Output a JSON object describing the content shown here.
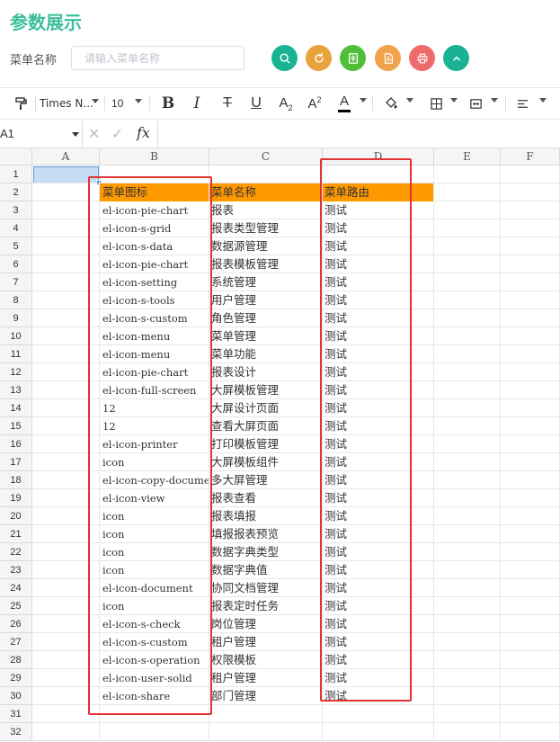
{
  "page": {
    "title": "参数展示"
  },
  "search": {
    "label": "菜单名称",
    "placeholder": "请输入菜单名称",
    "value": ""
  },
  "action_buttons": [
    {
      "name": "search-button",
      "icon": "search-icon",
      "color": "#19b394"
    },
    {
      "name": "reset-button",
      "icon": "refresh-icon",
      "color": "#e8a33d"
    },
    {
      "name": "export-excel-button",
      "icon": "excel-icon",
      "color": "#4fbf3a"
    },
    {
      "name": "export-pdf-button",
      "icon": "pdf-icon",
      "color": "#f0a34a"
    },
    {
      "name": "print-button",
      "icon": "printer-icon",
      "color": "#ee6b6b"
    },
    {
      "name": "collapse-button",
      "icon": "chevron-up-icon",
      "color": "#19b394"
    }
  ],
  "toolbar": {
    "font_family": "Times N...",
    "font_size": "10"
  },
  "formula_bar": {
    "cell_ref": "A1",
    "fx": "fx"
  },
  "sheet": {
    "columns": [
      "A",
      "B",
      "C",
      "D",
      "E",
      "F"
    ],
    "row_numbers": [
      "1",
      "2",
      "3",
      "4",
      "5",
      "6",
      "7",
      "8",
      "9",
      "10",
      "11",
      "12",
      "13",
      "14",
      "15",
      "16",
      "17",
      "18",
      "19",
      "20",
      "21",
      "22",
      "23",
      "24",
      "25",
      "26",
      "27",
      "28",
      "29",
      "30",
      "31",
      "32"
    ],
    "header": {
      "b": "菜单图标",
      "c": "菜单名称",
      "d": "菜单路由"
    },
    "rows": [
      {
        "b": "el-icon-pie-chart",
        "c": "报表",
        "d": "测试"
      },
      {
        "b": "el-icon-s-grid",
        "c": "报表类型管理",
        "d": "测试"
      },
      {
        "b": "el-icon-s-data",
        "c": "数据源管理",
        "d": "测试"
      },
      {
        "b": "el-icon-pie-chart",
        "c": "报表模板管理",
        "d": "测试"
      },
      {
        "b": "el-icon-setting",
        "c": "系统管理",
        "d": "测试"
      },
      {
        "b": "el-icon-s-tools",
        "c": "用户管理",
        "d": "测试"
      },
      {
        "b": "el-icon-s-custom",
        "c": "角色管理",
        "d": "测试"
      },
      {
        "b": "el-icon-menu",
        "c": "菜单管理",
        "d": "测试"
      },
      {
        "b": "el-icon-menu",
        "c": "菜单功能",
        "d": "测试"
      },
      {
        "b": "el-icon-pie-chart",
        "c": "报表设计",
        "d": "测试"
      },
      {
        "b": "el-icon-full-screen",
        "c": "大屏模板管理",
        "d": "测试"
      },
      {
        "b": "12",
        "c": "大屏设计页面",
        "d": "测试"
      },
      {
        "b": "12",
        "c": "查看大屏页面",
        "d": "测试"
      },
      {
        "b": "el-icon-printer",
        "c": "打印模板管理",
        "d": "测试"
      },
      {
        "b": "icon",
        "c": "大屏模板组件",
        "d": "测试"
      },
      {
        "b": "el-icon-copy-documer",
        "c": "多大屏管理",
        "d": "测试"
      },
      {
        "b": "el-icon-view",
        "c": "报表查看",
        "d": "测试"
      },
      {
        "b": "icon",
        "c": "报表填报",
        "d": "测试"
      },
      {
        "b": "icon",
        "c": "填报报表预览",
        "d": "测试"
      },
      {
        "b": "icon",
        "c": "数据字典类型",
        "d": "测试"
      },
      {
        "b": "icon",
        "c": "数据字典值",
        "d": "测试"
      },
      {
        "b": "el-icon-document",
        "c": "协同文档管理",
        "d": "测试"
      },
      {
        "b": "icon",
        "c": "报表定时任务",
        "d": "测试"
      },
      {
        "b": "el-icon-s-check",
        "c": "岗位管理",
        "d": "测试"
      },
      {
        "b": "el-icon-s-custom",
        "c": "租户管理",
        "d": "测试"
      },
      {
        "b": "el-icon-s-operation",
        "c": "权限模板",
        "d": "测试"
      },
      {
        "b": "el-icon-user-solid",
        "c": "租户管理",
        "d": "测试"
      },
      {
        "b": "el-icon-share",
        "c": "部门管理",
        "d": "测试"
      }
    ]
  }
}
